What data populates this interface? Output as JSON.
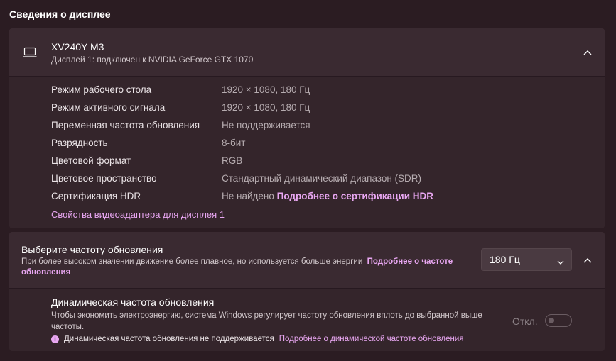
{
  "section_title": "Сведения о дисплее",
  "display": {
    "name": "XV240Y M3",
    "subtitle": "Дисплей 1: подключен к NVIDIA GeForce GTX 1070",
    "icon": "laptop-icon",
    "rows": [
      {
        "label": "Режим рабочего стола",
        "value": "1920 × 1080, 180 Гц"
      },
      {
        "label": "Режим активного сигнала",
        "value": "1920 × 1080, 180 Гц"
      },
      {
        "label": "Переменная частота обновления",
        "value": "Не поддерживается"
      },
      {
        "label": "Разрядность",
        "value": "8-бит"
      },
      {
        "label": "Цветовой формат",
        "value": "RGB"
      },
      {
        "label": "Цветовое пространство",
        "value": "Стандартный динамический диапазон (SDR)"
      },
      {
        "label": "Сертификация HDR",
        "value": "Не найдено",
        "link": "Подробнее о сертификации HDR"
      }
    ],
    "adapter_link": "Свойства видеоадаптера для дисплея 1"
  },
  "refresh": {
    "title": "Выберите частоту обновления",
    "description": "При более высоком значении движение более плавное, но используется больше энергии",
    "link": "Подробнее о частоте обновления",
    "selected": "180 Гц"
  },
  "dynamic": {
    "title": "Динамическая частота обновления",
    "description": "Чтобы экономить электроэнергию, система Windows регулирует частоту обновления вплоть до выбранной выше частоты.",
    "note": "Динамическая частота обновления не поддерживается",
    "note_link": "Подробнее о динамической частоте обновления",
    "toggle_label": "Откл.",
    "toggle_on": false
  },
  "colors": {
    "background": "#2b1c22",
    "card": "#34252b",
    "accent": "#e9a7f2"
  }
}
